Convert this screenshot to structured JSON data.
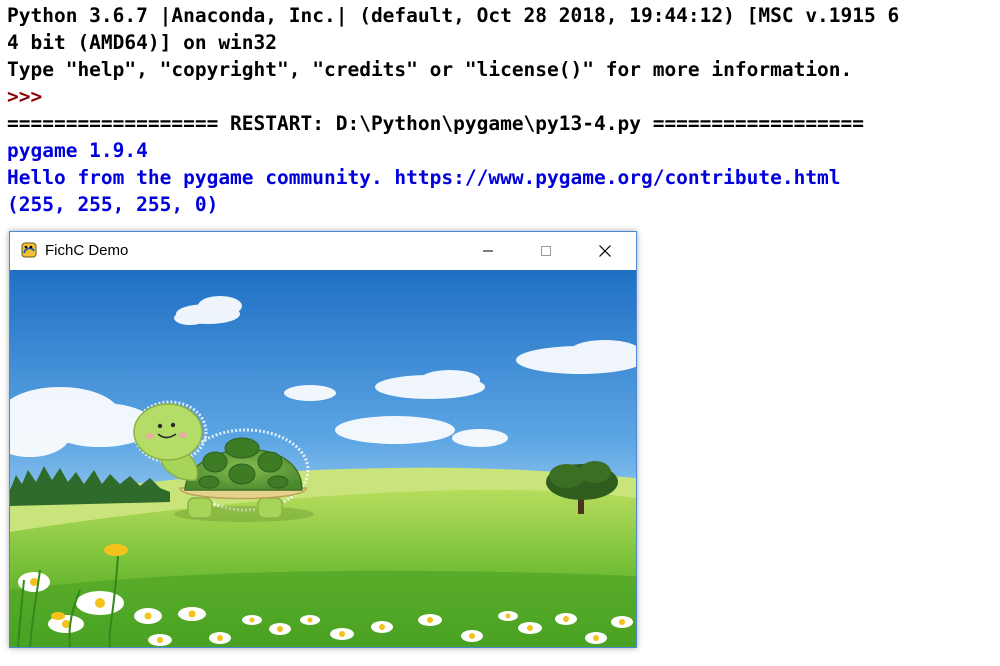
{
  "shell": {
    "lines": [
      "Python 3.6.7 |Anaconda, Inc.| (default, Oct 28 2018, 19:44:12) [MSC v.1915 6",
      "4 bit (AMD64)] on win32",
      "Type \"help\", \"copyright\", \"credits\" or \"license()\" for more information.",
      ">>> ",
      "================== RESTART: D:\\Python\\pygame\\py13-4.py ==================",
      "pygame 1.9.4",
      "Hello from the pygame community. https://www.pygame.org/contribute.html",
      "(255, 255, 255, 0)"
    ],
    "colors": {
      "default_text": "#000000",
      "prompt": "#8b0000",
      "output": "#0000dd"
    }
  },
  "window": {
    "title": "FichC Demo",
    "icons": {
      "app": "pygame-snake-icon",
      "minimize": "minimize-icon",
      "maximize": "maximize-icon",
      "close": "close-icon"
    }
  },
  "scene": {
    "sky_color": "#3a86d4",
    "grass_color": "#5eb82c",
    "turtle_shell_color": "#5a9a3a",
    "turtle_skin_color": "#a7d55a"
  }
}
